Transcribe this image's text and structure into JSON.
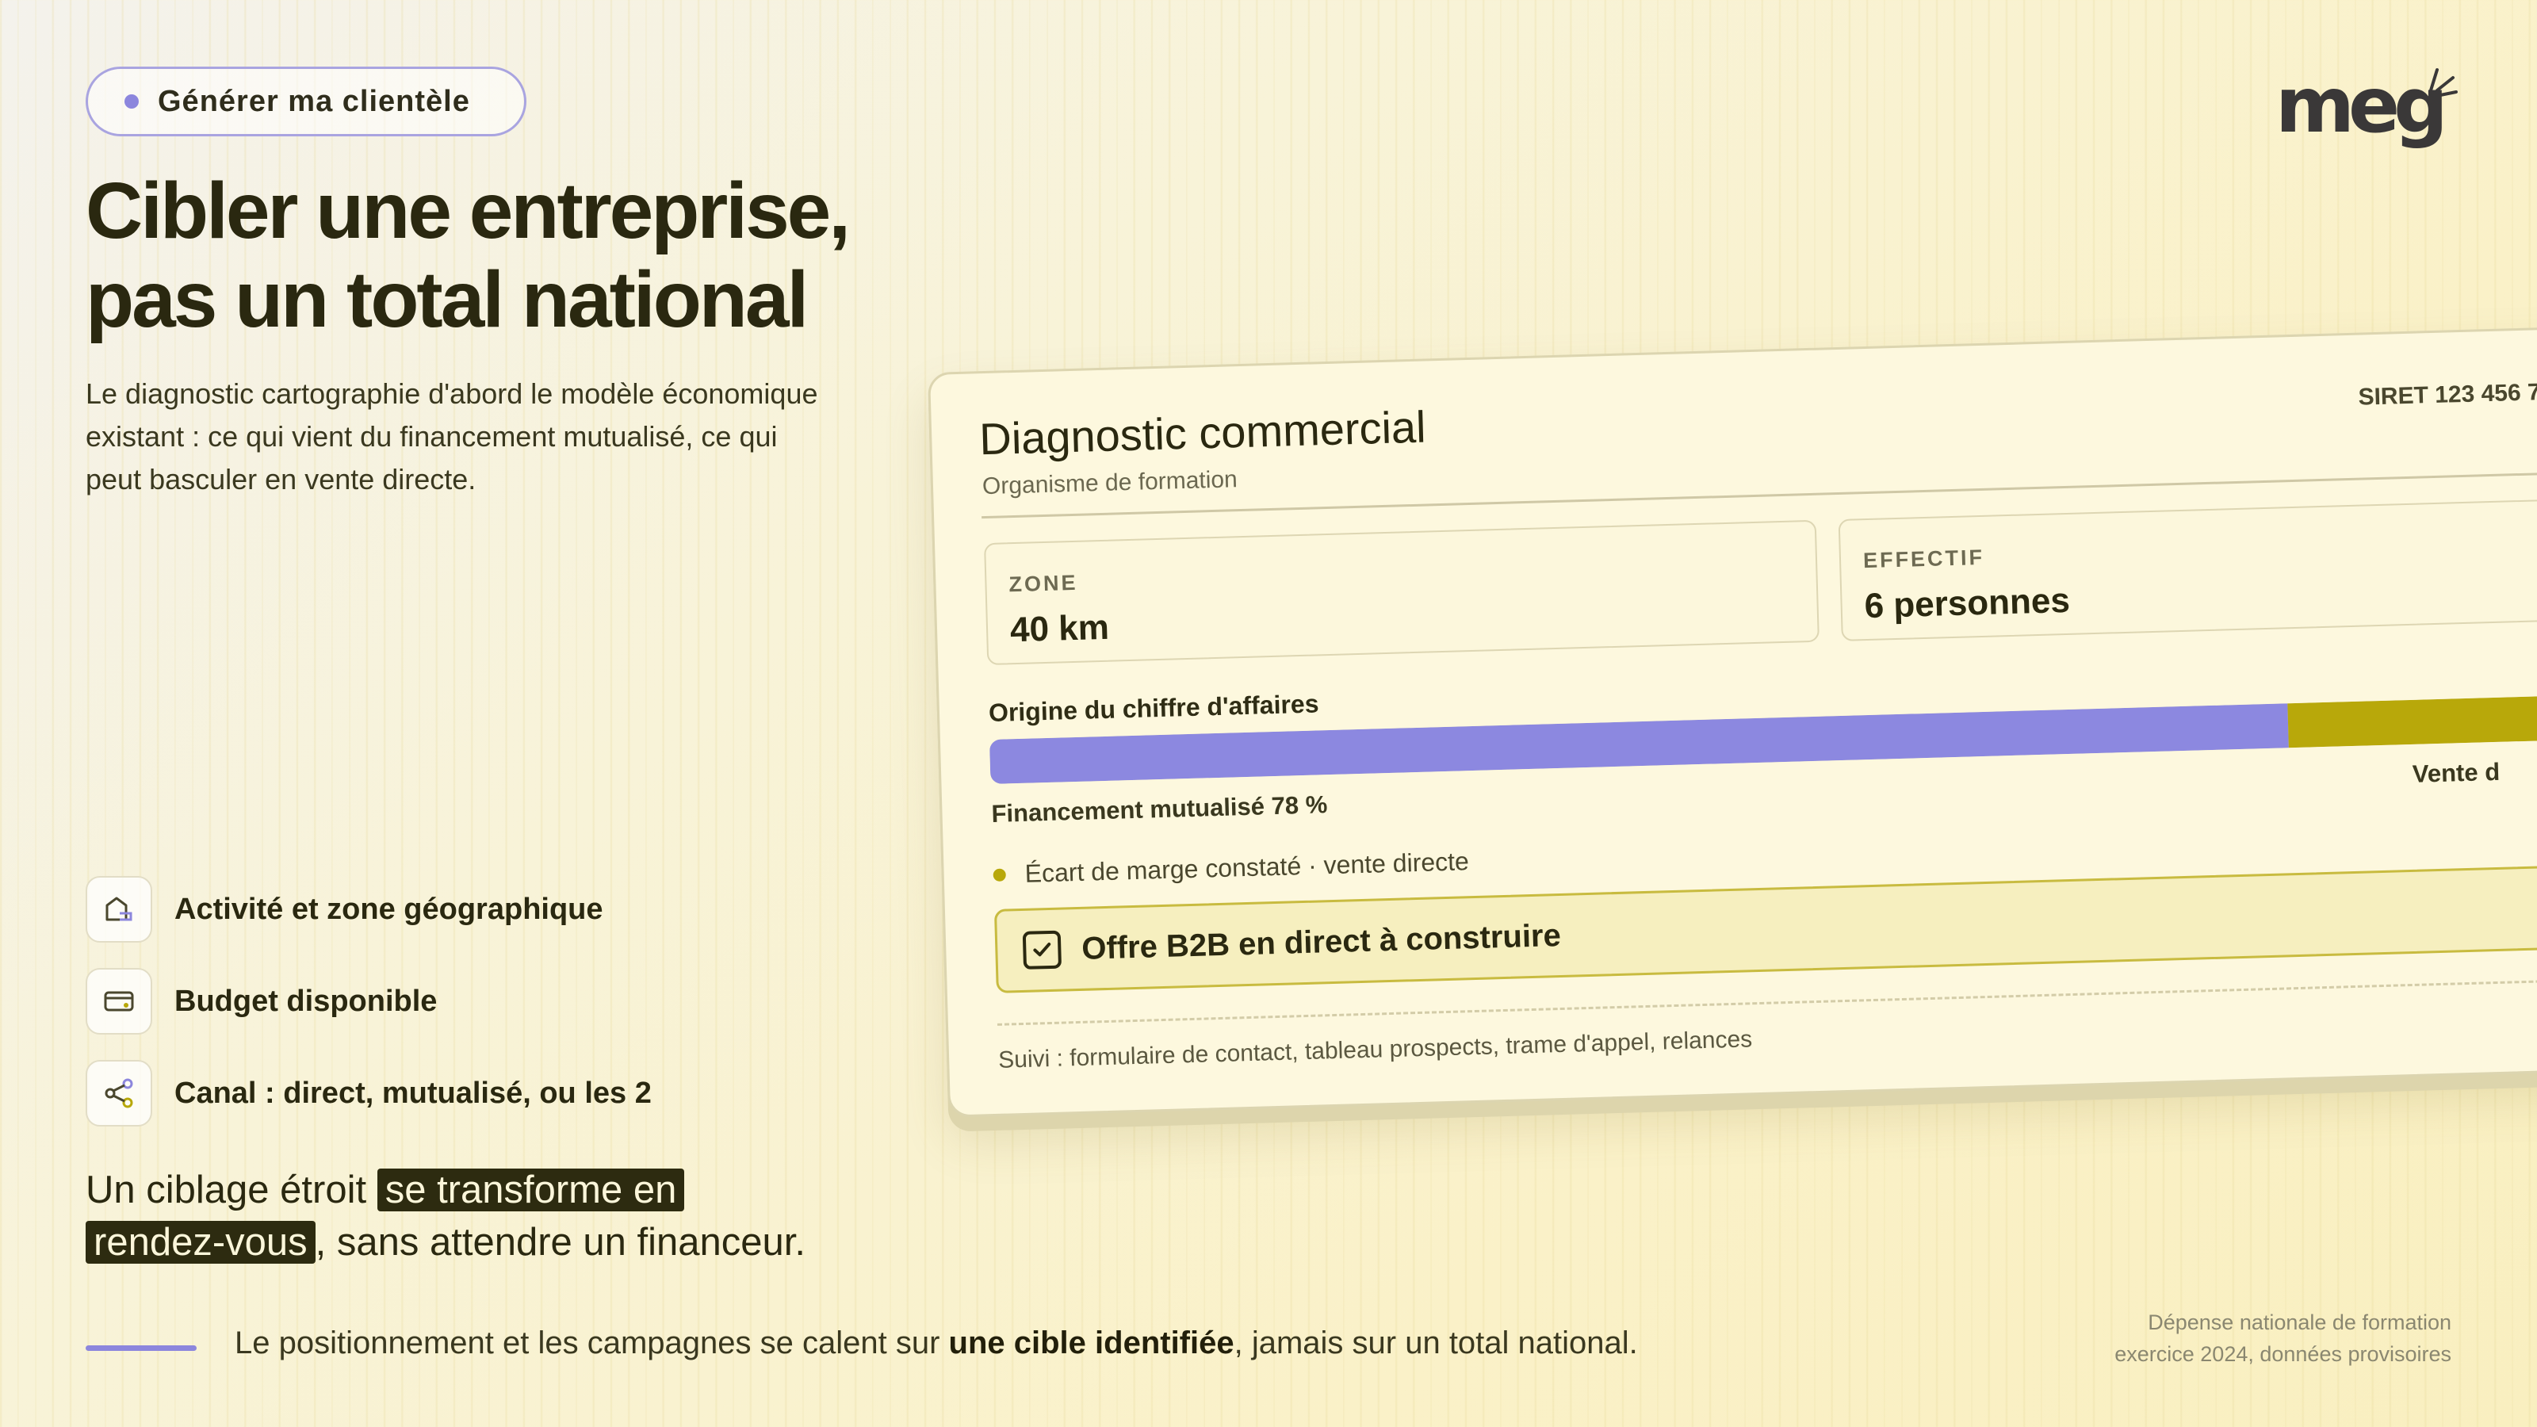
{
  "pill": {
    "label": "Générer ma clientèle"
  },
  "logo": {
    "text": "meg"
  },
  "title": {
    "line1": "Cibler une entreprise,",
    "line2": "pas un total national"
  },
  "lead": "Le diagnostic cartographie d'abord le modèle économique existant : ce qui vient du financement mutualisé, ce qui peut basculer en vente directe.",
  "features": [
    {
      "label": "Activité et zone géographique",
      "icon": "house-icon"
    },
    {
      "label": "Budget disponible",
      "icon": "wallet-icon"
    },
    {
      "label": "Canal : direct, mutualisé, ou les 2",
      "icon": "share-icon"
    }
  ],
  "claim": {
    "before": "Un ciblage étroit ",
    "hl1": "se transforme en",
    "hl2": "rendez-vous",
    "after": ", sans attendre un financeur."
  },
  "footer": {
    "before": "Le positionnement et les campagnes se calent sur ",
    "bold": "une cible identifiée",
    "after": ", jamais sur un total national."
  },
  "source": {
    "line1": "Dépense nationale de formation",
    "line2": "exercice 2024, données provisoires"
  },
  "card": {
    "title": "Diagnostic commercial",
    "subtitle": "Organisme de formation",
    "siret": "SIRET 123 456 7",
    "zone": {
      "key": "ZONE",
      "value": "40 km"
    },
    "effectif": {
      "key": "EFFECTIF",
      "value": "6 personnes"
    },
    "origin_label": "Origine du chiffre d'affaires",
    "split": {
      "mutualise_pct": 78,
      "direct_pct": 22
    },
    "financement_label": "Financement mutualisé 78 %",
    "vente_label": "Vente d",
    "ecart": "Écart de marge constaté · vente directe",
    "offer": "Offre B2B en direct à construire",
    "follow": "Suivi : formulaire de contact, tableau prospects, trame d'appel, relances"
  },
  "colors": {
    "accent": "#8c86dd",
    "olive": "#b8a80a",
    "dark": "#2a2810"
  }
}
